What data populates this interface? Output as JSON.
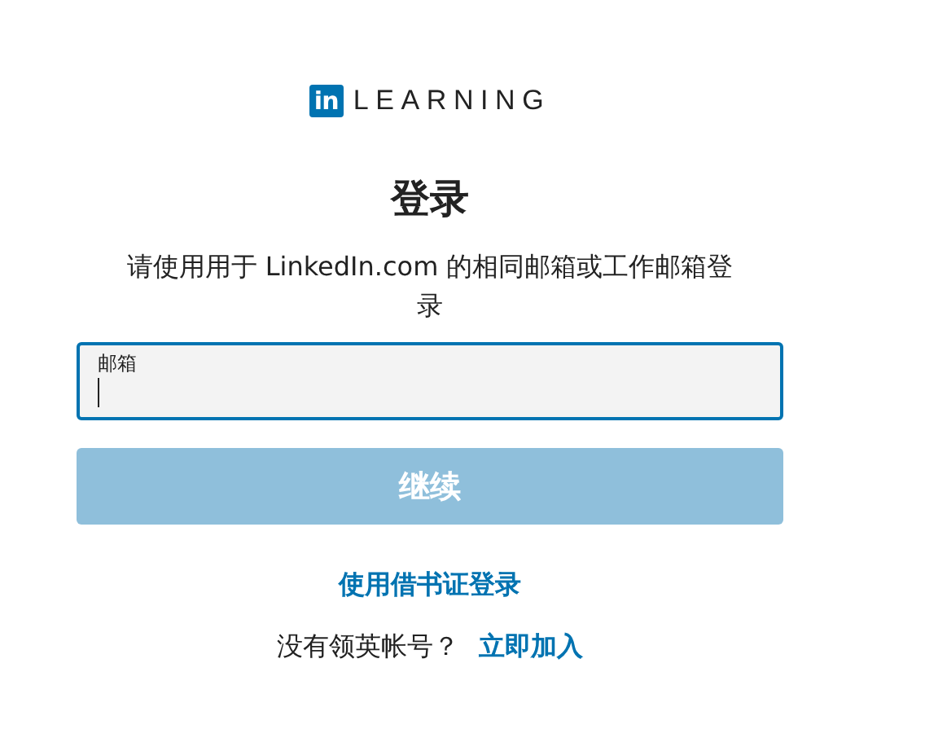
{
  "logo": {
    "badge": "in",
    "wordmark": "LEARNING"
  },
  "heading": "登录",
  "subtitle": "请使用用于 LinkedIn.com 的相同邮箱或工作邮箱登录",
  "email_field": {
    "label": "邮箱",
    "focused": true
  },
  "continue_button": {
    "label": "继续",
    "disabled": true
  },
  "library_link": "使用借书证登录",
  "signup": {
    "prompt": "没有领英帐号？",
    "link": "立即加入"
  }
}
